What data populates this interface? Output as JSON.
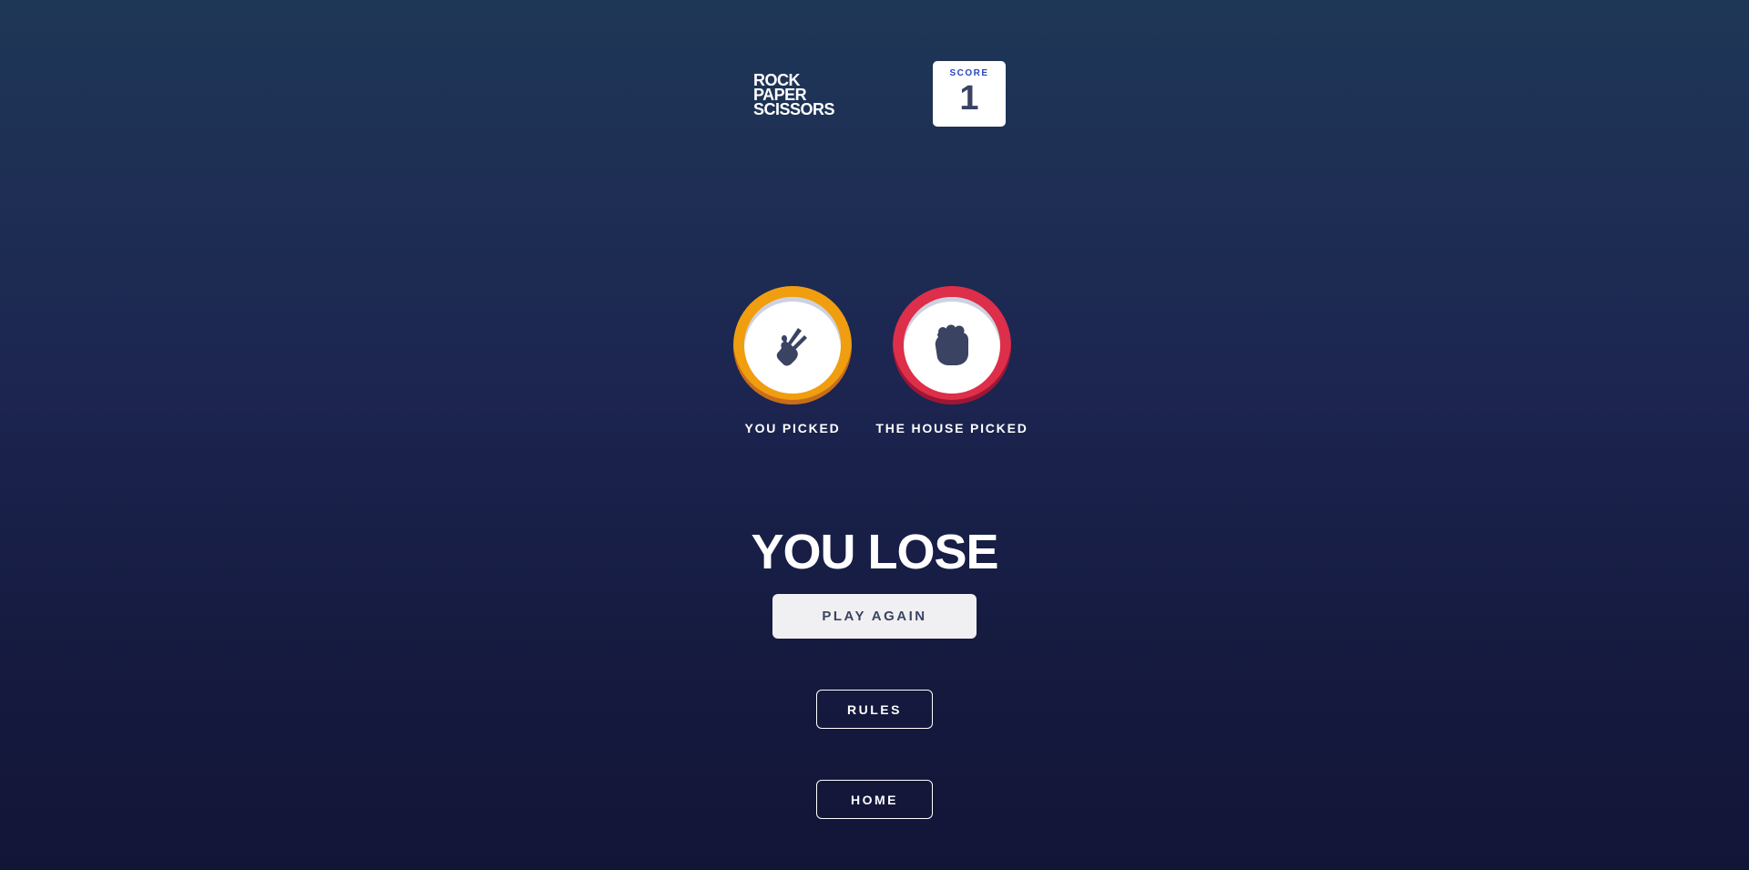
{
  "header": {
    "title_lines": [
      "ROCK",
      "PAPER",
      "SCISSORS"
    ],
    "score_label": "SCORE",
    "score_value": "1"
  },
  "picks": {
    "you": {
      "label": "YOU PICKED",
      "choice_icon": "scissors-hand-icon",
      "ring_color": "#f09e0f"
    },
    "house": {
      "label": "THE HOUSE PICKED",
      "choice_icon": "rock-fist-icon",
      "ring_color": "#dd2e4a"
    }
  },
  "result": {
    "text": "YOU LOSE",
    "play_again_label": "PLAY AGAIN"
  },
  "buttons": {
    "rules_label": "RULES",
    "home_label": "HOME"
  },
  "colors": {
    "icon": "#3b4363",
    "score_label": "#2a45c2",
    "background_top": "#1f3757",
    "background_bottom": "#131537"
  }
}
